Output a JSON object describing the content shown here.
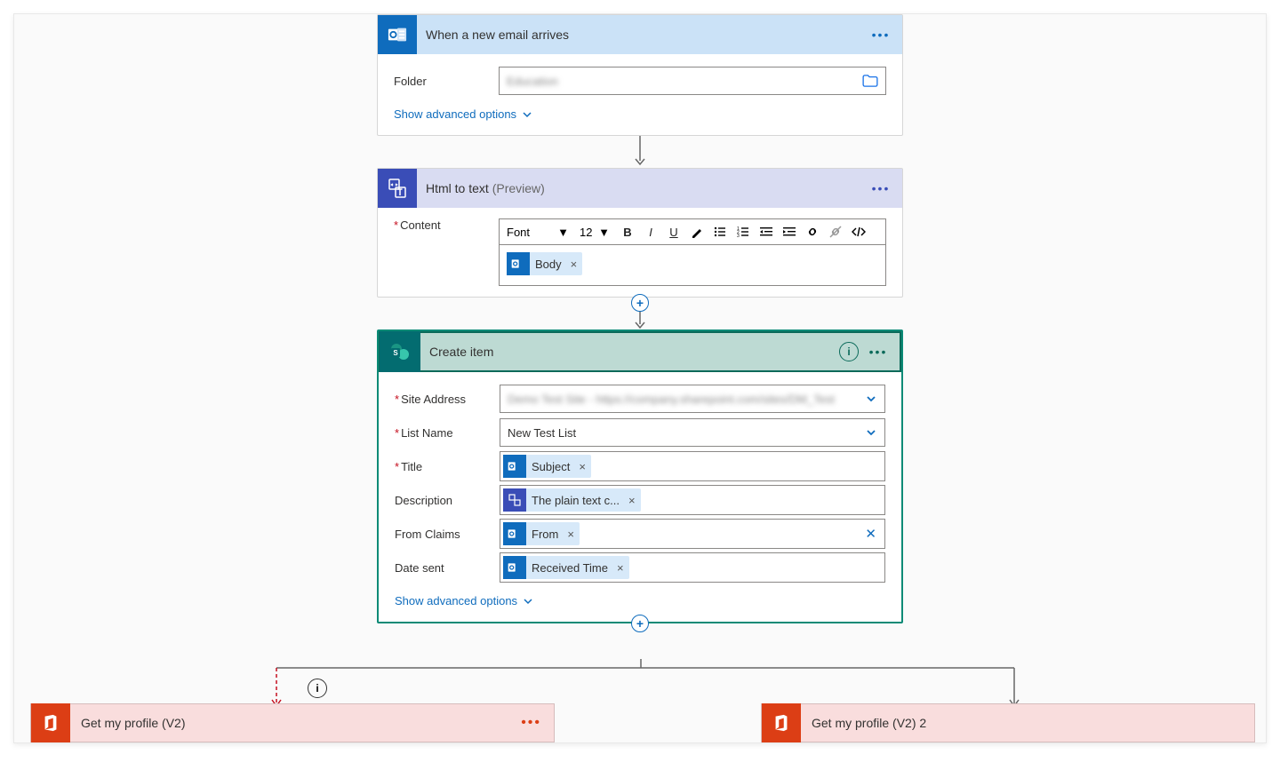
{
  "step1": {
    "title": "When a new email arrives",
    "folderLabel": "Folder",
    "folderValueBlurred": "Education",
    "advanced": "Show advanced options"
  },
  "step2": {
    "title": "Html to text ",
    "preview": "(Preview)",
    "contentLabel": "Content",
    "fontLabel": "Font",
    "fontSize": "12",
    "token": "Body"
  },
  "step3": {
    "title": "Create item",
    "siteLabel": "Site Address",
    "siteBlurred": "Demo Test Site - https://company.sharepoint.com/sites/DM_Test",
    "listLabel": "List Name",
    "listValue": "New Test List",
    "titleLabel": "Title",
    "titleToken": "Subject",
    "descLabel": "Description",
    "descToken": "The plain text c...",
    "fromLabel": "From Claims",
    "fromToken": "From",
    "dateLabel": "Date sent",
    "dateToken": "Received Time",
    "advanced": "Show advanced options"
  },
  "branchLeft": "Get my profile (V2)",
  "branchRight": "Get my profile (V2) 2"
}
